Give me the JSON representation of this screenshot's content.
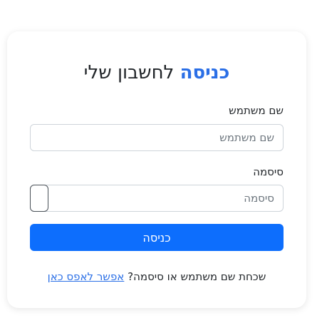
{
  "login": {
    "title_accent": "כניסה",
    "title_rest": "לחשבון שלי",
    "username_label": "שם משתמש",
    "username_placeholder": "שם משתמש",
    "password_label": "סיסמה",
    "password_placeholder": "סיסמה",
    "submit_label": "כניסה",
    "forgot_text": "שכחת שם משתמש או סיסמה?",
    "reset_link": "אפשר לאפס כאן"
  },
  "colors": {
    "accent": "#2b6fe6",
    "button": "#0d6efd"
  }
}
